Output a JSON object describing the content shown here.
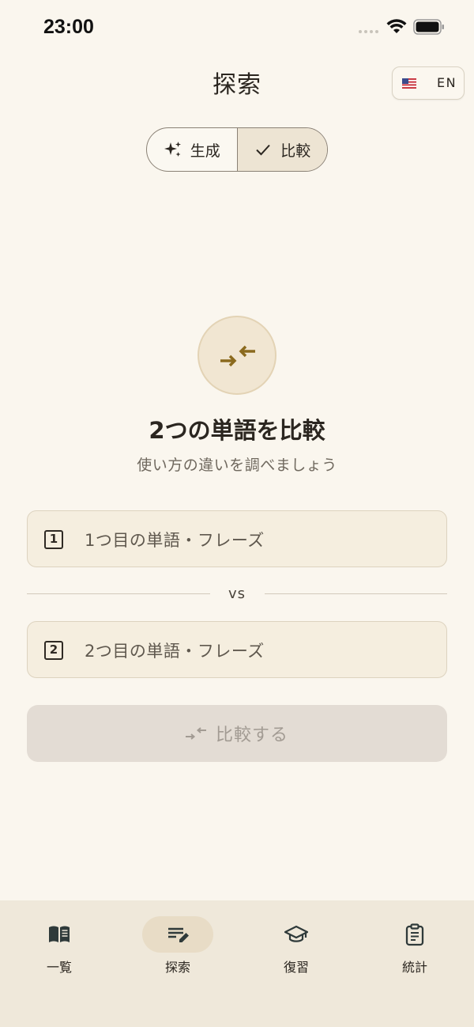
{
  "status_bar": {
    "time": "23:00"
  },
  "header": {
    "title": "探索",
    "language": {
      "code": "EN",
      "flag_icon": "us-flag-icon"
    }
  },
  "mode_switch": {
    "segments": [
      {
        "label": "生成",
        "icon": "sparkles-icon",
        "selected": false
      },
      {
        "label": "比較",
        "icon": "checkmark-icon",
        "selected": true
      }
    ]
  },
  "hero": {
    "icon": "compare-arrows-icon",
    "title": "2つの単語を比較",
    "subtitle": "使い方の違いを調べましょう"
  },
  "form": {
    "first": {
      "badge": "1",
      "placeholder": "1つ目の単語・フレーズ"
    },
    "divider_label": "vs",
    "second": {
      "badge": "2",
      "placeholder": "2つ目の単語・フレーズ"
    },
    "submit": {
      "label": "比較する",
      "enabled": false
    }
  },
  "tab_bar": {
    "items": [
      {
        "label": "一覧",
        "icon": "book-icon",
        "active": false
      },
      {
        "label": "探索",
        "icon": "edit-list-icon",
        "active": true
      },
      {
        "label": "復習",
        "icon": "graduation-cap-icon",
        "active": false
      },
      {
        "label": "統計",
        "icon": "clipboard-icon",
        "active": false
      }
    ]
  },
  "colors": {
    "background": "#faf6ee",
    "accent": "#8b6a1e",
    "field_background": "#f5eedf",
    "tab_bar_background": "#efe8da",
    "disabled_button": "#e3dcd4"
  }
}
